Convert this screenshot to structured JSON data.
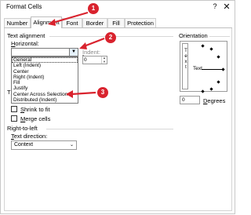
{
  "dialog": {
    "title": "Format Cells",
    "help_glyph": "?",
    "close_glyph": "✕"
  },
  "tabs": [
    {
      "label": "Number",
      "active": false
    },
    {
      "label": "Alignment",
      "active": true
    },
    {
      "label": "Font",
      "active": false
    },
    {
      "label": "Border",
      "active": false
    },
    {
      "label": "Fill",
      "active": false
    },
    {
      "label": "Protection",
      "active": false
    }
  ],
  "text_alignment": {
    "section_title": "Text alignment",
    "horizontal_label": "Horizontal:",
    "indent_label": "Indent:",
    "indent_value": "0",
    "horizontal_options": [
      "General",
      "Left (Indent)",
      "Center",
      "Right (Indent)",
      "Fill",
      "Justify",
      "Center Across Selection",
      "Distributed (Indent)"
    ],
    "selected_index": 0
  },
  "text_control": {
    "section_initial": "T",
    "shrink_label": "Shrink to fit",
    "merge_label": "Merge cells"
  },
  "right_to_left": {
    "section_title": "Right-to-left",
    "direction_label": "Text direction:",
    "direction_value": "Context"
  },
  "orientation": {
    "section_title": "Orientation",
    "vertical_text": "Text",
    "horizontal_text": "Text",
    "degrees_value": "0",
    "degrees_label": "Degrees"
  },
  "annotations": {
    "badges": [
      "1",
      "2",
      "3"
    ],
    "color": "#d9232e"
  },
  "icons": {
    "dropdown_arrow": "chevron-down-icon",
    "spin_arrows": "spin-icon"
  }
}
